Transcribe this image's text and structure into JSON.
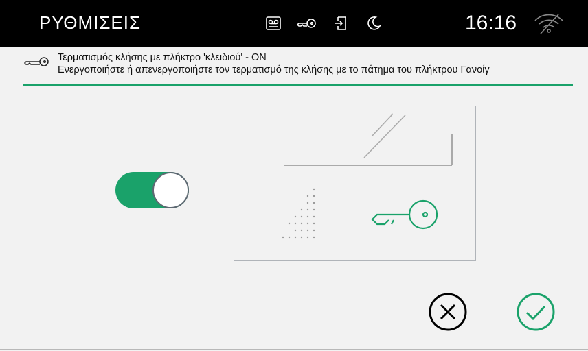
{
  "header": {
    "title": "ΡΥΘΜΙΣΕΙΣ",
    "time": "16:16",
    "status_icons": [
      "voicemail-icon",
      "key-icon",
      "door-exit-icon",
      "moon-icon",
      "wifi-off-icon"
    ]
  },
  "setting": {
    "title": "Τερματισμός κλήσης με πλήκτρο 'κλειδιού' - ON",
    "description": "Ενεργοποιήστε ή απενεργοποιήστε τον τερματισμό της κλήσης με το πάτημα του πλήκτρου Γανοίγ",
    "icon": "key-icon",
    "enabled": true
  },
  "colors": {
    "accent": "#1aa26a",
    "topbar": "#000000",
    "background": "#f2f2f2"
  },
  "actions": {
    "cancel_icon": "close-circle-icon",
    "confirm_icon": "check-circle-icon"
  }
}
